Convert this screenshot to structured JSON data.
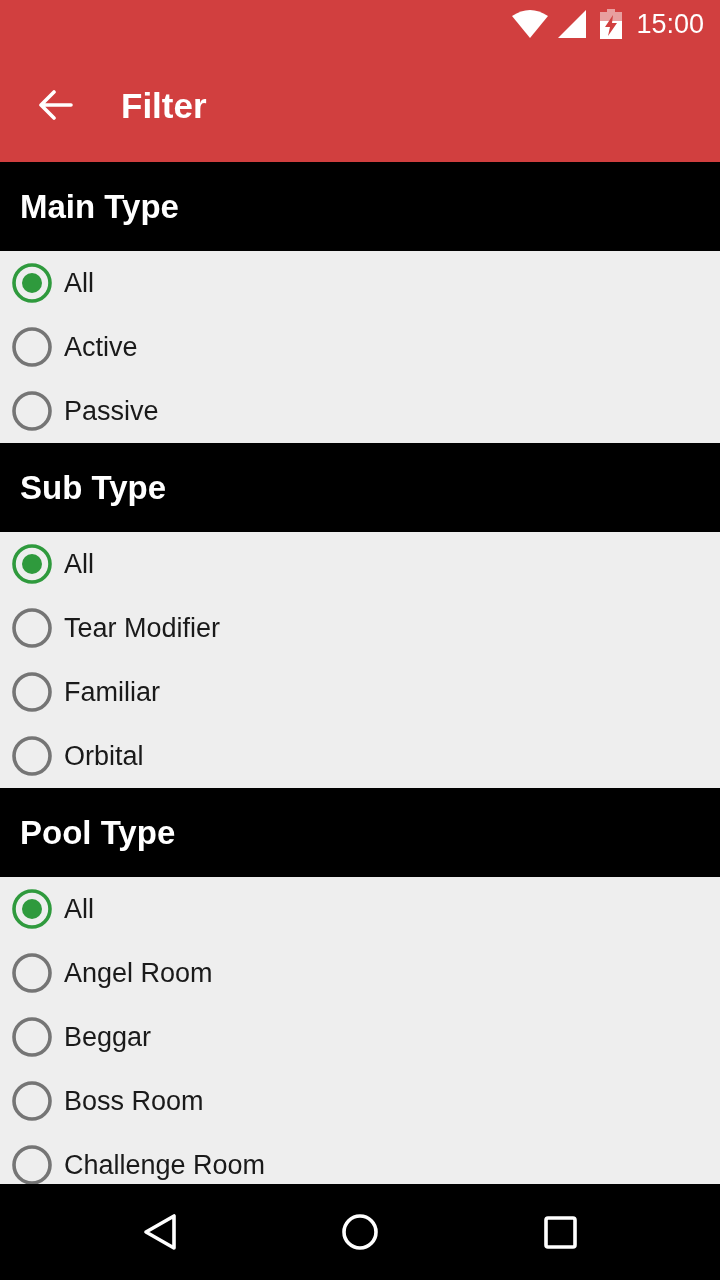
{
  "status_bar": {
    "time": "15:00"
  },
  "app_bar": {
    "title": "Filter"
  },
  "sections": [
    {
      "title": "Main Type",
      "options": [
        {
          "label": "All",
          "selected": true
        },
        {
          "label": "Active",
          "selected": false
        },
        {
          "label": "Passive",
          "selected": false
        }
      ]
    },
    {
      "title": "Sub Type",
      "options": [
        {
          "label": "All",
          "selected": true
        },
        {
          "label": "Tear Modifier",
          "selected": false
        },
        {
          "label": "Familiar",
          "selected": false
        },
        {
          "label": "Orbital",
          "selected": false
        }
      ]
    },
    {
      "title": "Pool Type",
      "options": [
        {
          "label": "All",
          "selected": true
        },
        {
          "label": "Angel Room",
          "selected": false
        },
        {
          "label": "Beggar",
          "selected": false
        },
        {
          "label": "Boss Room",
          "selected": false
        },
        {
          "label": "Challenge Room",
          "selected": false
        }
      ]
    }
  ]
}
